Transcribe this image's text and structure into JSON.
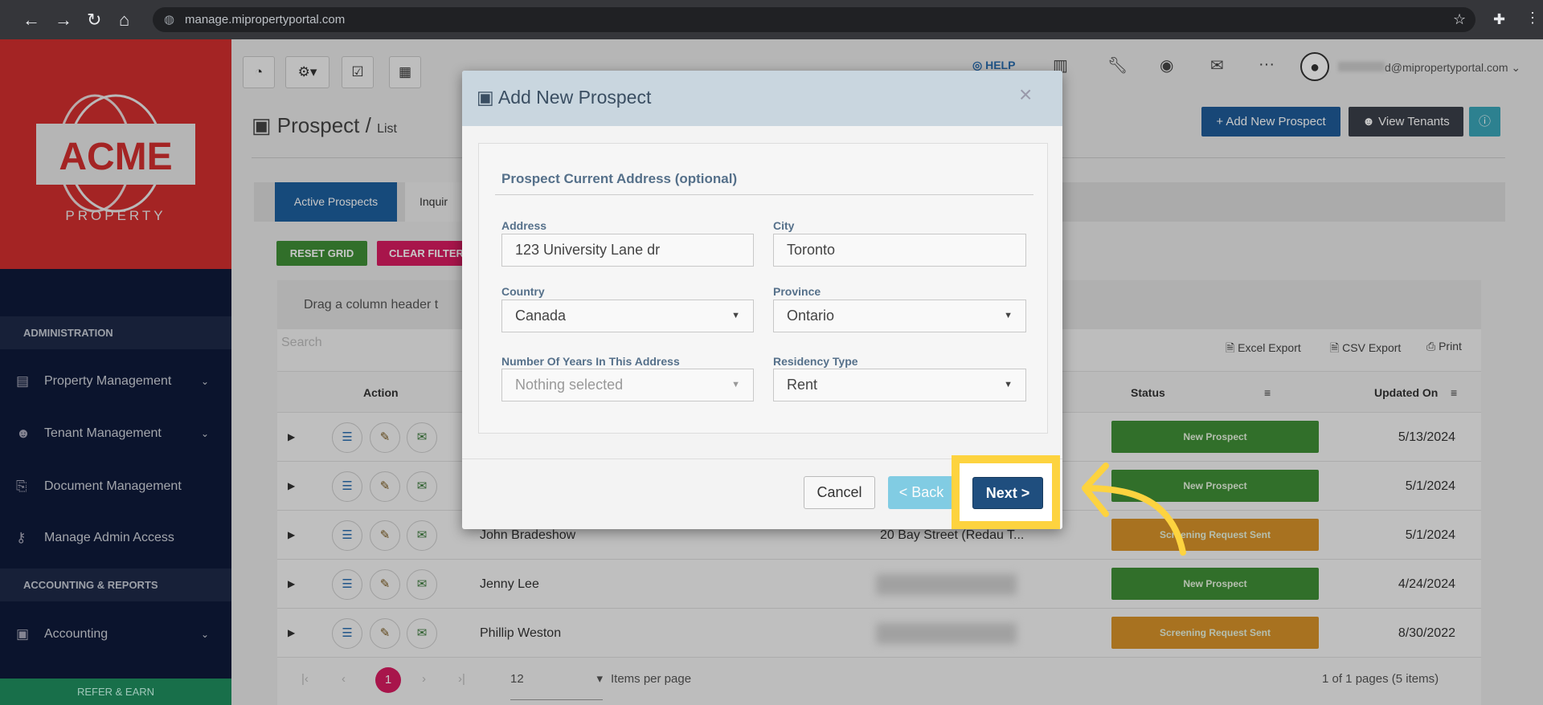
{
  "browser": {
    "url": "manage.mipropertyportal.com"
  },
  "sidebar": {
    "logo_text": "ACME",
    "logo_sub": "PROPERTY",
    "section_admin": "ADMINISTRATION",
    "items": [
      {
        "label": "Property Management"
      },
      {
        "label": "Tenant Management"
      },
      {
        "label": "Document Management"
      },
      {
        "label": "Manage Admin Access"
      }
    ],
    "section_accounting": "ACCOUNTING & REPORTS",
    "accounting": "Accounting",
    "refer": "REFER & EARN"
  },
  "header": {
    "help": "HELP",
    "user_email": "d@mipropertyportal.com"
  },
  "page": {
    "title": "Prospect",
    "crumb": "List",
    "add_btn": "+ Add New Prospect",
    "view_tenants": "View Tenants",
    "tabs": [
      "Active Prospects",
      "Inquir"
    ],
    "reset": "RESET GRID",
    "clear": "CLEAR FILTER",
    "drag_hint": "Drag a column header t",
    "search_placeholder": "Search",
    "excel": "Excel Export",
    "csv": "CSV Export",
    "print": "Print"
  },
  "grid": {
    "headers": {
      "action": "Action",
      "status": "Status",
      "updated": "Updated On"
    },
    "rows": [
      {
        "name": "",
        "address": "",
        "status": "New Prospect",
        "color": "#3f8f36",
        "updated": "5/13/2024"
      },
      {
        "name": "",
        "address": "",
        "status": "New Prospect",
        "color": "#3f8f36",
        "updated": "5/1/2024"
      },
      {
        "name": "John Bradeshow",
        "address": "20 Bay Street (Redau T...",
        "status": "Screening Request Sent",
        "color": "#d8932a",
        "updated": "5/1/2024"
      },
      {
        "name": "Jenny Lee",
        "address": "",
        "status": "New Prospect",
        "color": "#3f8f36",
        "updated": "4/24/2024"
      },
      {
        "name": "Phillip Weston",
        "address": "",
        "status": "Screening Request Sent",
        "color": "#d8932a",
        "updated": "8/30/2022"
      }
    ],
    "page": "1",
    "page_size": "12",
    "per_page": "Items per page",
    "summary": "1 of 1 pages (5 items)"
  },
  "modal": {
    "title": "Add New Prospect",
    "close": "×",
    "section": "Prospect Current Address (optional)",
    "address_label": "Address",
    "address": "123 University Lane dr",
    "city_label": "City",
    "city": "Toronto",
    "country_label": "Country",
    "country": "Canada",
    "province_label": "Province",
    "province": "Ontario",
    "years_label": "Number Of Years In This Address",
    "years": "Nothing selected",
    "residency_label": "Residency Type",
    "residency": "Rent",
    "cancel": "Cancel",
    "back": "< Back",
    "next": "Next >"
  }
}
